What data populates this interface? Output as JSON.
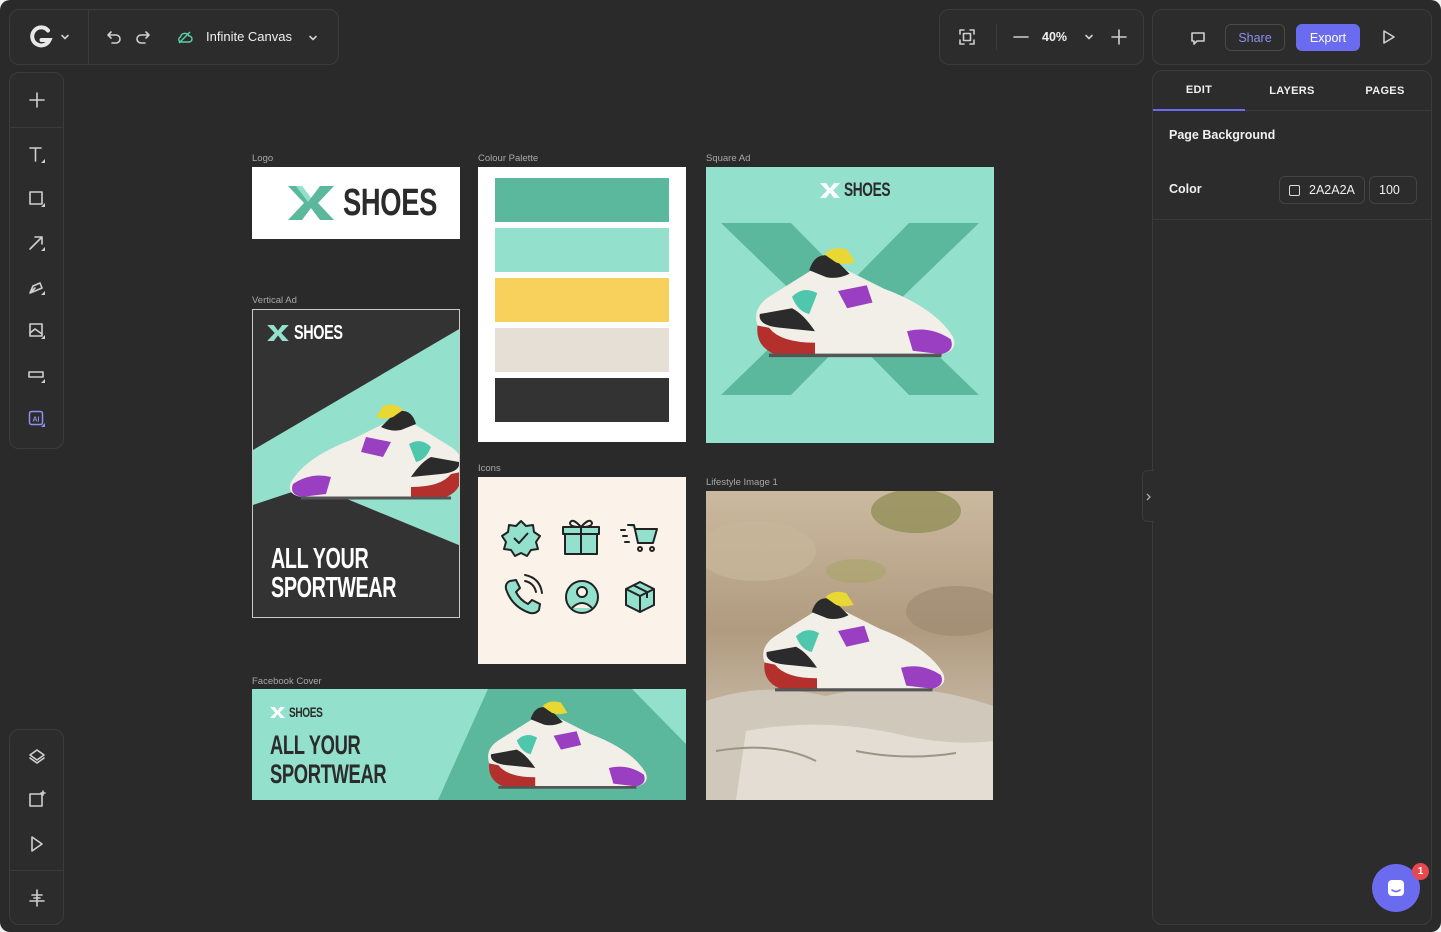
{
  "header": {
    "canvas_title": "Infinite Canvas",
    "zoom": "40%",
    "share_label": "Share",
    "export_label": "Export"
  },
  "panel": {
    "tabs": [
      "EDIT",
      "LAYERS",
      "PAGES"
    ],
    "active_tab": "EDIT",
    "section_title": "Page Background",
    "color_label": "Color",
    "color_value": "2A2A2A",
    "opacity_value": "100"
  },
  "canvas": {
    "frames": {
      "logo": "Logo",
      "palette": "Colour Palette",
      "square_ad": "Square Ad",
      "vertical_ad": "Vertical Ad",
      "icons": "Icons",
      "lifestyle": "Lifestyle Image 1",
      "facebook": "Facebook Cover"
    },
    "brand_name": "SHOES",
    "headline_line1": "ALL YOUR",
    "headline_line2": "SPORTWEAR",
    "palette_colors": [
      "#5cb89d",
      "#93e0cc",
      "#f7d15c",
      "#e5dfd6",
      "#333333"
    ]
  },
  "chat": {
    "badge_count": "1"
  },
  "colors": {
    "accent": "#6b6bef",
    "canvas_bg": "#2A2A2A",
    "brand_teal": "#5cb89d",
    "brand_mint": "#93e0cc"
  },
  "icons": [
    "app-logo-icon",
    "chevron-down-icon",
    "undo-icon",
    "redo-icon",
    "cloud-saved-icon",
    "fit-frame-icon",
    "zoom-out-icon",
    "zoom-in-icon",
    "comment-icon",
    "play-icon",
    "plus-icon",
    "text-icon",
    "rectangle-icon",
    "arrow-line-icon",
    "pen-icon",
    "image-icon",
    "input-field-icon",
    "ai-icon",
    "layers-icon",
    "add-frame-icon",
    "cursor-icon",
    "align-icon",
    "chat-icon",
    "badge-check-icon",
    "gift-icon",
    "cart-icon",
    "phone-icon",
    "user-icon",
    "box-icon"
  ]
}
